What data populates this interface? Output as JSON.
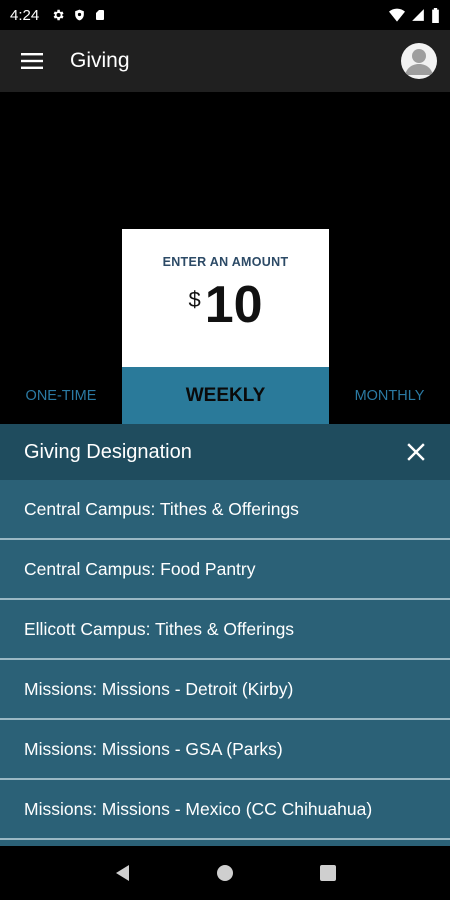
{
  "status_bar": {
    "time": "4:24",
    "icons_left": [
      "gear-icon",
      "shield-icon",
      "sd-card-icon"
    ],
    "icons_right": [
      "wifi-icon",
      "signal-icon",
      "battery-icon"
    ]
  },
  "app_bar": {
    "title": "Giving",
    "menu_icon": "hamburger-menu-icon",
    "avatar_icon": "user-avatar-icon"
  },
  "amount_card": {
    "label": "ENTER AN AMOUNT",
    "currency_symbol": "$",
    "amount": "10"
  },
  "frequency": {
    "options": [
      "ONE-TIME",
      "WEEKLY",
      "MONTHLY"
    ],
    "selected": "WEEKLY"
  },
  "designation_sheet": {
    "title": "Giving Designation",
    "items": [
      "Central Campus: Tithes & Offerings",
      "Central Campus: Food Pantry",
      "Ellicott Campus: Tithes & Offerings",
      "Missions: Missions - Detroit (Kirby)",
      "Missions: Missions - GSA (Parks)",
      "Missions: Missions - Mexico (CC Chihuahua)"
    ]
  },
  "colors": {
    "accent": "#2a7a9a",
    "sheet_bg": "#2b6177",
    "sheet_header_bg": "#1f4c5e",
    "app_bar_bg": "#202020",
    "frequency_text": "#2b7aa3",
    "amount_label": "#2c4a66"
  },
  "nav_bar": {
    "icons": [
      "back-icon",
      "home-icon",
      "recents-icon"
    ]
  }
}
